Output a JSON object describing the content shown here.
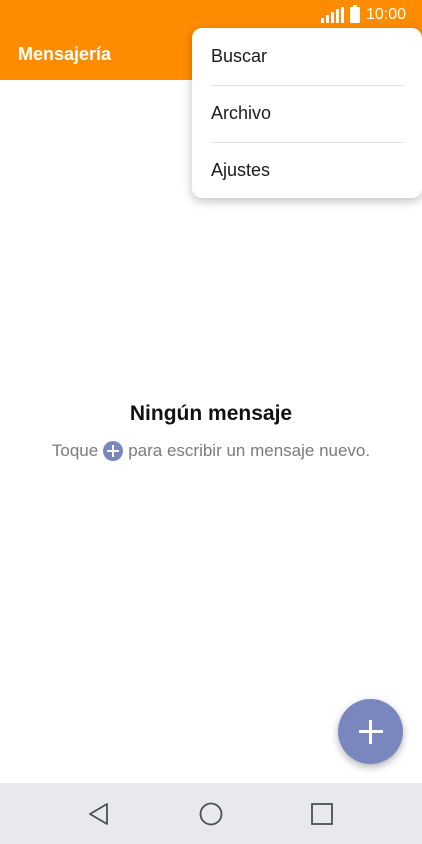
{
  "status_bar": {
    "time": "10:00",
    "icons": [
      "signal-icon",
      "battery-icon"
    ]
  },
  "app_bar": {
    "title": "Mensajería"
  },
  "overflow_menu": {
    "items": [
      {
        "label": "Buscar"
      },
      {
        "label": "Archivo"
      },
      {
        "label": "Ajustes"
      }
    ]
  },
  "empty_state": {
    "title": "Ningún mensaje",
    "hint_before": "Toque",
    "hint_icon": "plus-circle-icon",
    "hint_after": "para escribir un mensaje nuevo."
  },
  "fab": {
    "icon": "plus-icon"
  },
  "nav_bar": {
    "icons": [
      "back-icon",
      "home-icon",
      "recent-apps-icon"
    ]
  },
  "colors": {
    "accent": "#ff8c00",
    "fab": "#7a86be",
    "nav_bar": "#e8e9ec"
  }
}
